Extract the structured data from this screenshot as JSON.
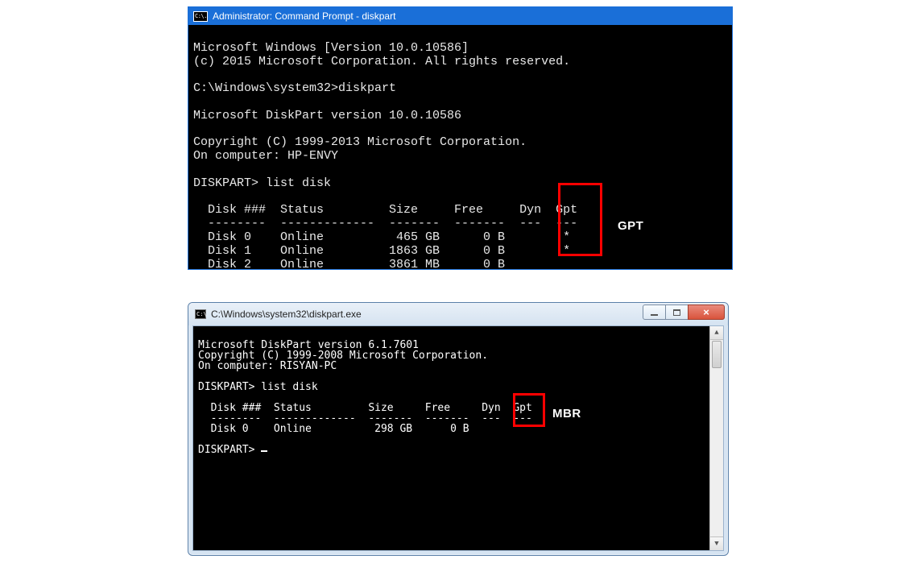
{
  "win10": {
    "title_icon_text": "C:\\.",
    "title": "Administrator: Command Prompt - diskpart",
    "lines": {
      "l1": "Microsoft Windows [Version 10.0.10586]",
      "l2": "(c) 2015 Microsoft Corporation. All rights reserved.",
      "l3": "",
      "l4": "C:\\Windows\\system32>diskpart",
      "l5": "",
      "l6": "Microsoft DiskPart version 10.0.10586",
      "l7": "",
      "l8": "Copyright (C) 1999-2013 Microsoft Corporation.",
      "l9": "On computer: HP-ENVY",
      "l10": "",
      "l11": "DISKPART> list disk",
      "l12": "",
      "l13": "  Disk ###  Status         Size     Free     Dyn  Gpt",
      "l14": "  --------  -------------  -------  -------  ---  ---",
      "l15": "  Disk 0    Online          465 GB      0 B        *",
      "l16": "  Disk 1    Online         1863 GB      0 B        *",
      "l17": "  Disk 2    Online         3861 MB      0 B"
    }
  },
  "win7": {
    "title_icon_text": "C:\\",
    "title": "C:\\Windows\\system32\\diskpart.exe",
    "lines": {
      "l1": "Microsoft DiskPart version 6.1.7601",
      "l2": "Copyright (C) 1999-2008 Microsoft Corporation.",
      "l3": "On computer: RISYAN-PC",
      "l4": "",
      "l5": "DISKPART> list disk",
      "l6": "",
      "l7": "  Disk ###  Status         Size     Free     Dyn  Gpt",
      "l8": "  --------  -------------  -------  -------  ---  ---",
      "l9": "  Disk 0    Online          298 GB      0 B",
      "l10": "",
      "l11prefix": "DISKPART> "
    }
  },
  "labels": {
    "gpt": "GPT",
    "mbr": "MBR"
  }
}
